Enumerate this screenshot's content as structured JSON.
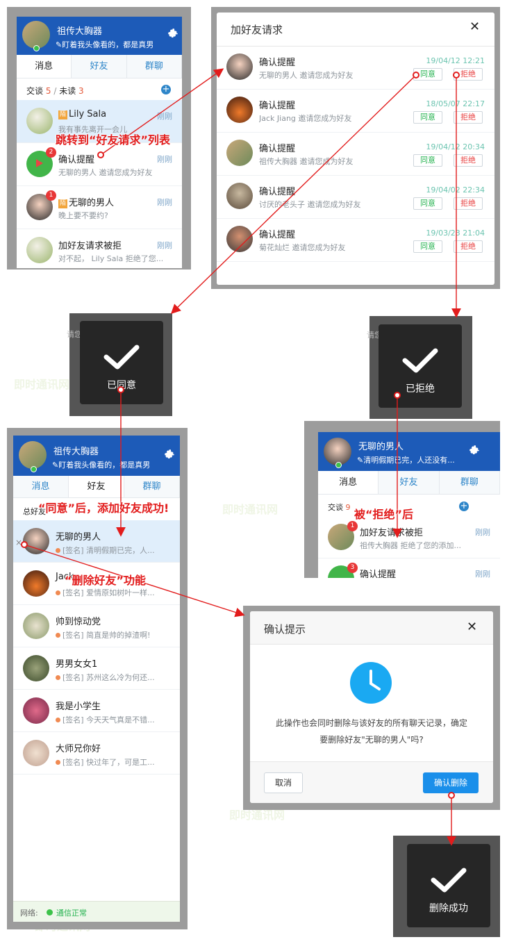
{
  "panel_a": {
    "user_name": "祖传大胸器",
    "signature": "盯着我头像看的，都是真男",
    "tabs": [
      "消息",
      "好友",
      "群聊"
    ],
    "stat_label_talk": "交谈",
    "stat_talk": "5",
    "stat_sep": "/",
    "stat_label_unread": "未读",
    "stat_unread": "3",
    "rows": [
      {
        "title": "Lily Sala",
        "tag": "陌",
        "time": "刚刚",
        "sub": "我有事先离开一会儿",
        "badge": ""
      },
      {
        "title": "确认提醒",
        "tag": "",
        "time": "刚刚",
        "sub": "无聊的男人 邀请您成为好友",
        "badge": "2"
      },
      {
        "title": "无聊的男人",
        "tag": "陌",
        "time": "刚刚",
        "sub": "晚上要不要约?",
        "badge": "1"
      },
      {
        "title": "加好友请求被拒",
        "tag": "",
        "time": "刚刚",
        "sub": "对不起， Lily Sala 拒绝了您...",
        "badge": ""
      }
    ]
  },
  "request_dialog": {
    "title": "加好友请求",
    "accept_label": "同意",
    "reject_label": "拒绝",
    "items": [
      {
        "title": "确认提醒",
        "sub": "无聊的男人 邀请您成为好友",
        "time": "19/04/12 12:21"
      },
      {
        "title": "确认提醒",
        "sub": "Jack Jiang 邀请您成为好友",
        "time": "18/05/07 22:17"
      },
      {
        "title": "确认提醒",
        "sub": "祖传大胸器 邀请您成为好友",
        "time": "19/04/12 20:34"
      },
      {
        "title": "确认提醒",
        "sub": "讨厌的老头子 邀请您成为好友",
        "time": "19/04/02 22:34"
      },
      {
        "title": "确认提醒",
        "sub": "菊花灿烂 邀请您成为好友",
        "time": "19/03/23 21:04"
      }
    ]
  },
  "toasts": {
    "agreed": "已同意",
    "rejected": "已拒绝",
    "deleted": "删除成功",
    "bg_text": "请您成为好友"
  },
  "panel_b": {
    "user_name": "祖传大胸器",
    "signature": "盯着我头像看的，都是真男",
    "tabs": [
      "消息",
      "好友",
      "群聊"
    ],
    "stat": "总好友",
    "friends": [
      {
        "name": "无聊的男人",
        "sig": "[签名] 清明假期已完，人..."
      },
      {
        "name": "Jack",
        "sig": "[签名] 爱情原如树叶一样..."
      },
      {
        "name": "帅到惊动党",
        "sig": "[签名] 简直是帅的掉渣啊!"
      },
      {
        "name": "男男女女1",
        "sig": "[签名] 苏州这么冷为何还..."
      },
      {
        "name": "我是小学生",
        "sig": "[签名] 今天天气真是不错..."
      },
      {
        "name": "大师兄你好",
        "sig": "[签名] 快过年了，可是工..."
      }
    ],
    "net_label": "网络:",
    "net_status": "通信正常"
  },
  "panel_c": {
    "user_name": "无聊的男人",
    "signature": "清明假期已完，人还没有...",
    "tabs": [
      "消息",
      "好友",
      "群聊"
    ],
    "stat_label": "交谈",
    "stat_val": "9",
    "rows": [
      {
        "title": "加好友请求被拒",
        "time": "刚刚",
        "sub": "祖传大胸器 拒绝了您的添加...",
        "badge": "1"
      },
      {
        "title": "确认提醒",
        "time": "刚刚",
        "sub": "",
        "badge": "3"
      }
    ]
  },
  "confirm_dialog": {
    "title": "确认提示",
    "message_line1": "此操作也会同时删除与该好友的所有聊天记录，确定",
    "message_line2": "要删除好友\"无聊的男人\"吗?",
    "cancel_label": "取消",
    "ok_label": "确认删除"
  },
  "annotations": {
    "jump": "跳转到“好友请求”列表",
    "agree": "“同意”后，添加好友成功!",
    "reject": "被“拒绝”后",
    "delete": "“删除好友”功能"
  },
  "watermark": "即时通讯网",
  "colors": {
    "header": "#1d5bb8",
    "accent": "#2f86c9",
    "annotation": "#e21c1c",
    "accept": "#27b351",
    "reject": "#e84545",
    "badge": "#e83737"
  }
}
